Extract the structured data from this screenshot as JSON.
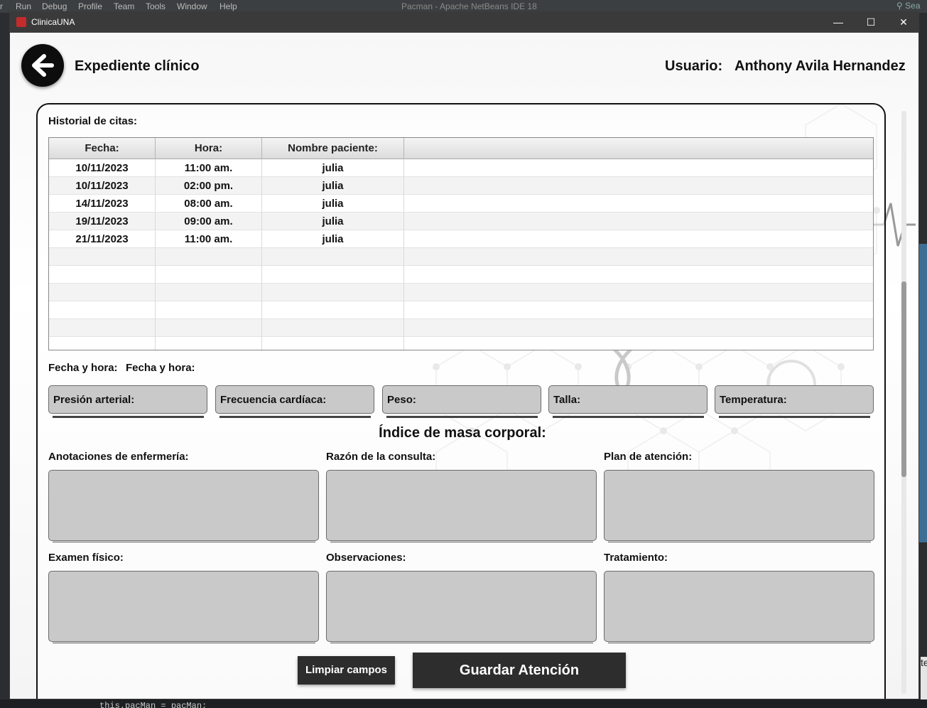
{
  "ide": {
    "menu": [
      "r",
      "Run",
      "Debug",
      "Profile",
      "Team",
      "Tools",
      "Window",
      "Help"
    ],
    "title": "Pacman - Apache NetBeans IDE 18",
    "search": "Sea",
    "right_tab_char": "te",
    "code_line": "this.pacMan = pacMan;"
  },
  "window": {
    "title": "ClinicaUNA",
    "minimize": "—",
    "maximize": "☐",
    "close": "✕"
  },
  "header": {
    "title": "Expediente clínico",
    "user_label": "Usuario:",
    "user_name": "Anthony Avila Hernandez"
  },
  "history": {
    "label": "Historial de citas:",
    "columns": [
      "Fecha:",
      "Hora:",
      "Nombre paciente:"
    ],
    "rows": [
      [
        "10/11/2023",
        "11:00 am.",
        "julia"
      ],
      [
        "10/11/2023",
        "02:00 pm.",
        "julia"
      ],
      [
        "14/11/2023",
        "08:00 am.",
        "julia"
      ],
      [
        "19/11/2023",
        "09:00 am.",
        "julia"
      ],
      [
        "21/11/2023",
        "11:00 am.",
        "julia"
      ]
    ]
  },
  "datetime": {
    "label": "Fecha y hora:",
    "value": "Fecha y hora:"
  },
  "vitals": {
    "pressure": "Presión arterial:",
    "heart_rate": "Frecuencia cardíaca:",
    "weight": "Peso:",
    "height": "Talla:",
    "temperature": "Temperatura:"
  },
  "imc_label": "Índice de masa corporal:",
  "notes": {
    "nursing": "Anotaciones de enfermería:",
    "reason": "Razón de la consulta:",
    "plan": "Plan de atención:",
    "exam": "Examen físico:",
    "observations": "Observaciones:",
    "treatment": "Tratamiento:"
  },
  "buttons": {
    "clear": "Limpiar campos",
    "save": "Guardar Atención"
  },
  "colors": {
    "field_bg": "#c9c9c9",
    "button_bg": "#2d2d2d",
    "titlebar_bg": "#3a3a3a"
  }
}
